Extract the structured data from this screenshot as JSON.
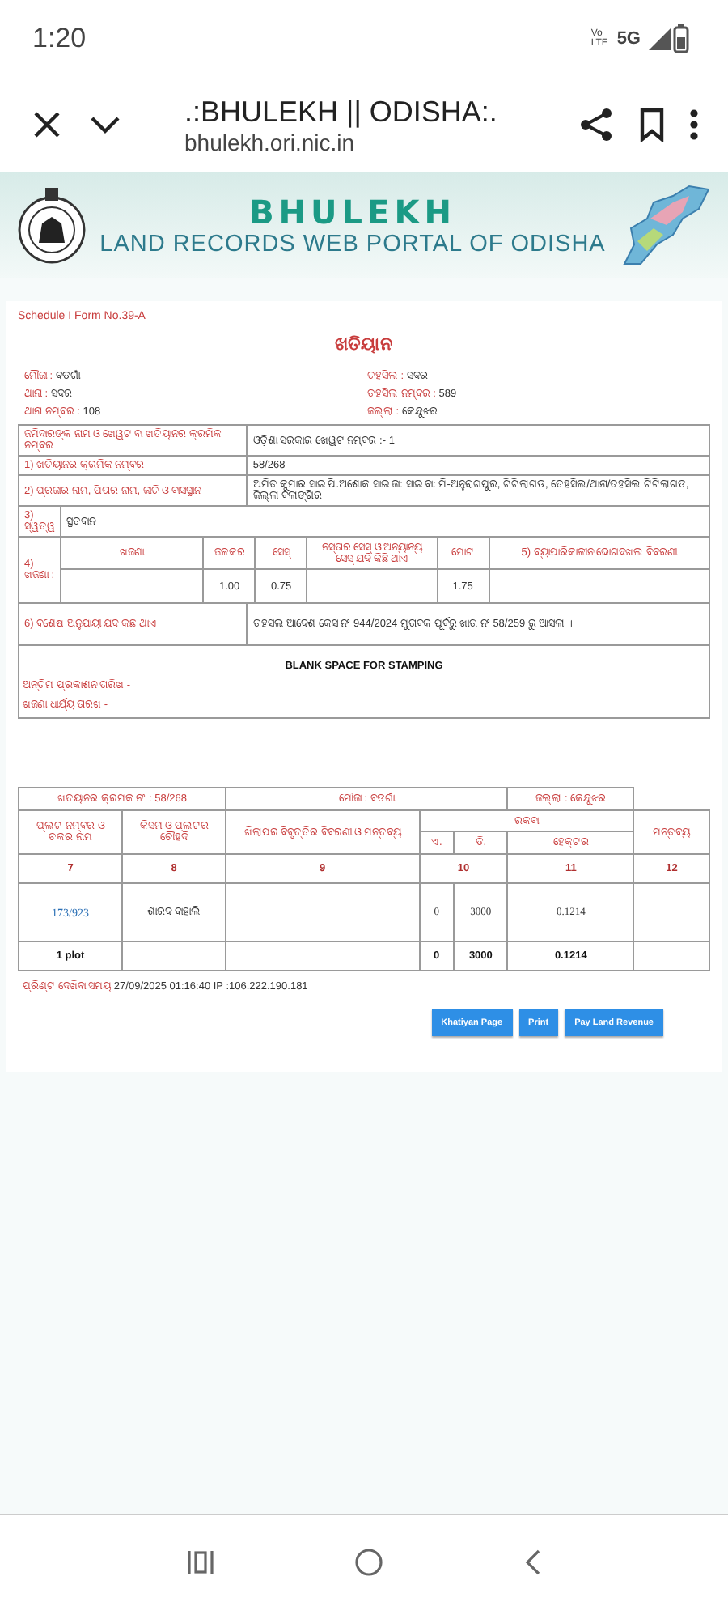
{
  "status_bar": {
    "time": "1:20",
    "volte": "Vo LTE",
    "network": "5G"
  },
  "browser": {
    "title": ".:BHULEKH || ODISHA:.",
    "url": "bhulekh.ori.nic.in"
  },
  "banner": {
    "logo_text": "BHULEKH",
    "subtitle": "LAND RECORDS WEB PORTAL OF ODISHA"
  },
  "form": {
    "form_no": "Schedule I Form No.39-A",
    "title": "ଖତିୟାନ",
    "info": [
      {
        "label": "ମୌଜା :",
        "value": "ବଡଗାଁ"
      },
      {
        "label": "ତହସିଲ :",
        "value": "ସଦର"
      },
      {
        "label": "ଥାନା :",
        "value": "ସଦର"
      },
      {
        "label": "ତହସିଲ ନମ୍ବର :",
        "value": "589"
      },
      {
        "label": "ଥାନା ନମ୍ବର :",
        "value": "108"
      },
      {
        "label": "ଜିଲ୍ଲା :",
        "value": "କେନ୍ଦୁଝର"
      }
    ],
    "details": [
      {
        "label": "ଜମିଦାରଙ୍କ ନାମ ଓ ଖେୱଟ ବା ଖତିୟାନର କ୍ରମିକ ନମ୍ବର",
        "value": "ଓଡ଼ିଶା ସରକାର ଖେୱଟ ନମ୍ବର :- 1"
      },
      {
        "label": "1) ଖତିୟାନର କ୍ରମିକ ନମ୍ବର",
        "value": "58/268"
      },
      {
        "label": "2) ପ୍ରଜାର ନାମ, ପିତାର ନାମ, ଜାତି ଓ ବାସସ୍ଥାନ",
        "value": "ଅମିତ କୁମାର ସାଇ ପି.ଅଶୋକ ସାଇ ଜା: ସାଇ ବା: ମି-ଅନୁରାଗପୁର, ଟିଟିଲାଗଡ, ତେହସିଲ/ଥାନା/ତହସିଲ ଟିଟିଲାଗଡ, ଜିଲ୍ଲା ବଲାଙ୍ଗିର"
      }
    ],
    "tenure": {
      "label": "3) ସ୍ୱତ୍ୱ",
      "value": "ସ୍ଥିତିବାନ"
    },
    "rent": {
      "label": "4) ଖଜଣା :",
      "columns": [
        {
          "heading": "ଖଜଣା"
        },
        {
          "heading": "ଜଳକର",
          "value": "1.00"
        },
        {
          "heading": "ସେସ୍",
          "value": "0.75"
        },
        {
          "heading": "ନିସ୍ତାର ସେସ୍ ଓ ଅନ୍ୟାନ୍ୟ ସେସ୍ ଯଦି କିଛି ଥାଏ"
        },
        {
          "heading": "ମୋଟ",
          "value": "1.75"
        },
        {
          "heading": "5) ବ୍ୟାପାରିକାଳୀନ ଭୋଗଦଖଲ ବିବରଣୀ"
        }
      ]
    },
    "remarks": {
      "label": "6) ବିଶେଷ ଅନୁଯାୟୀ ଯଦି କିଛି ଥାଏ",
      "value": "ତହସିଲ ଆଦେଶ କେସ ନଂ 944/2024 ମୁତାବକ ପୂର୍ବରୁ ଖାତା ନଂ 58/259 ରୁ ଆସିଲା ।"
    },
    "stamping": {
      "heading": "BLANK SPACE FOR STAMPING",
      "lines": [
        "ଅନ୍ତିମ ପ୍ରକାଶନ ତାରିଖ -",
        "ଖଜଣା ଧାର୍ଯ୍ୟ ତାରିଖ -"
      ]
    }
  },
  "plots": {
    "header": [
      "ଖତିୟାନର କ୍ରମିକ ନଂ : 58/268",
      "ମୌଜା : ବଡଗାଁ",
      "ଜିଲ୍ଲା : କେନ୍ଦୁଝର"
    ],
    "columns": [
      "ପ୍ଲଟ ନମ୍ବର ଓ ଚକର ନାମ",
      "କିସମ ଓ ପ୍ଲଟର ଚୌହଦି",
      "ଖିଲାପର ବିବୃତ୍ତିର ବିବରଣୀ ଓ ମନ୍ତବ୍ୟ",
      "ମନ୍ତବ୍ୟ"
    ],
    "area_heading": "ରକବା",
    "area_columns": [
      "ଏ.",
      "ଡି.",
      "ହେକ୍ଟର"
    ],
    "numbers": [
      "7",
      "8",
      "9",
      "10",
      "11",
      "12"
    ],
    "rows": [
      {
        "plot": "173/923",
        "kisam": "ଶାରଦ ବାହାଲି",
        "acre": "0",
        "decimal": "3000",
        "hectare": "0.1214"
      }
    ],
    "total": {
      "label": "1 plot",
      "acre": "0",
      "decimal": "3000",
      "hectare": "0.1214"
    }
  },
  "footer": {
    "label": "ପ୍ରିଣ୍ଟ ଦେଖିବା ସମୟ",
    "value": "27/09/2025 01:16:40 IP :106.222.190.181"
  },
  "buttons": [
    "Khatiyan Page",
    "Print",
    "Pay Land Revenue"
  ]
}
